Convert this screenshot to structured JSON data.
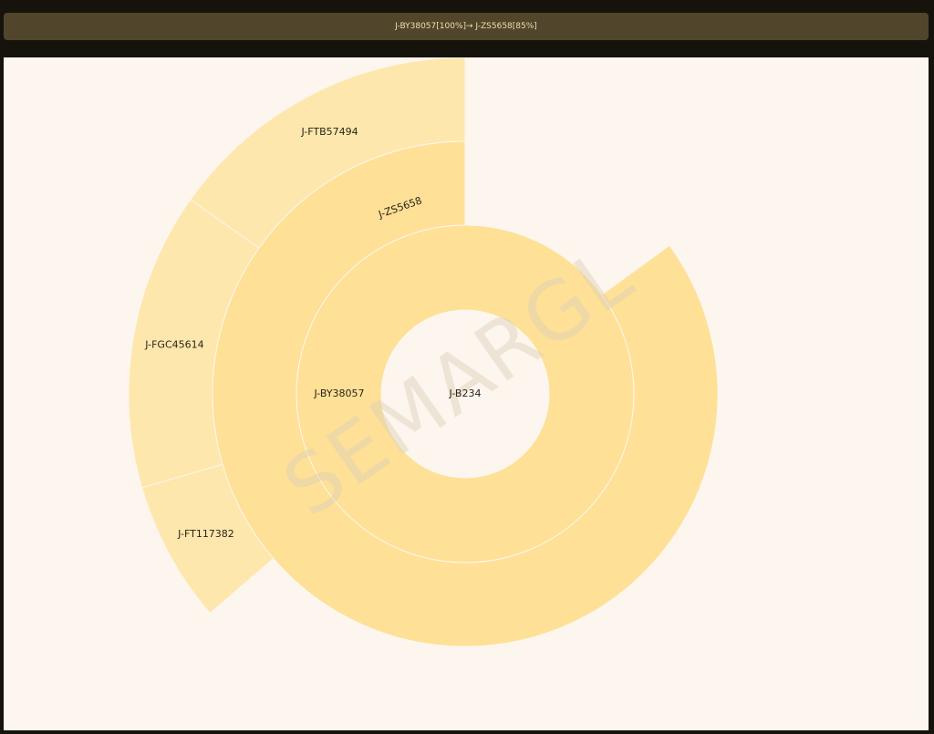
{
  "breadcrumb": {
    "path": "J-BY38057[100%]→ J-ZS5658[85%]"
  },
  "watermark": {
    "text": "SEMARGL"
  },
  "colors": {
    "page_bg": "#16130c",
    "breadcrumb_bg": "#51462b",
    "breadcrumb_text": "#f0deb0",
    "panel_bg": "#fdf6ee",
    "ring_fill": "#fee096",
    "outer_fill": "#fee7ad",
    "separator": "#fdf6ee",
    "label": "#2a2418"
  },
  "chart_data": {
    "type": "sunburst",
    "root": "J-B234",
    "start_angle_deg": 90,
    "levels": [
      {
        "name": "J-BY38057",
        "parent": "J-B234",
        "fraction_of_parent": 1.0,
        "start_fraction": 0.0
      },
      {
        "name": "J-ZS5658",
        "parent": "J-BY38057",
        "fraction_of_parent": 0.85,
        "start_fraction": 0.0
      },
      {
        "name": "J-FTB57494",
        "parent": "J-ZS5658",
        "fraction_of_root": 0.152,
        "start_fraction": 0.0
      },
      {
        "name": "J-FGC45614",
        "parent": "J-ZS5658",
        "fraction_of_root": 0.143,
        "start_fraction": 0.152
      },
      {
        "name": "J-FT117382",
        "parent": "J-ZS5658",
        "fraction_of_root": 0.068,
        "start_fraction": 0.295
      }
    ]
  }
}
